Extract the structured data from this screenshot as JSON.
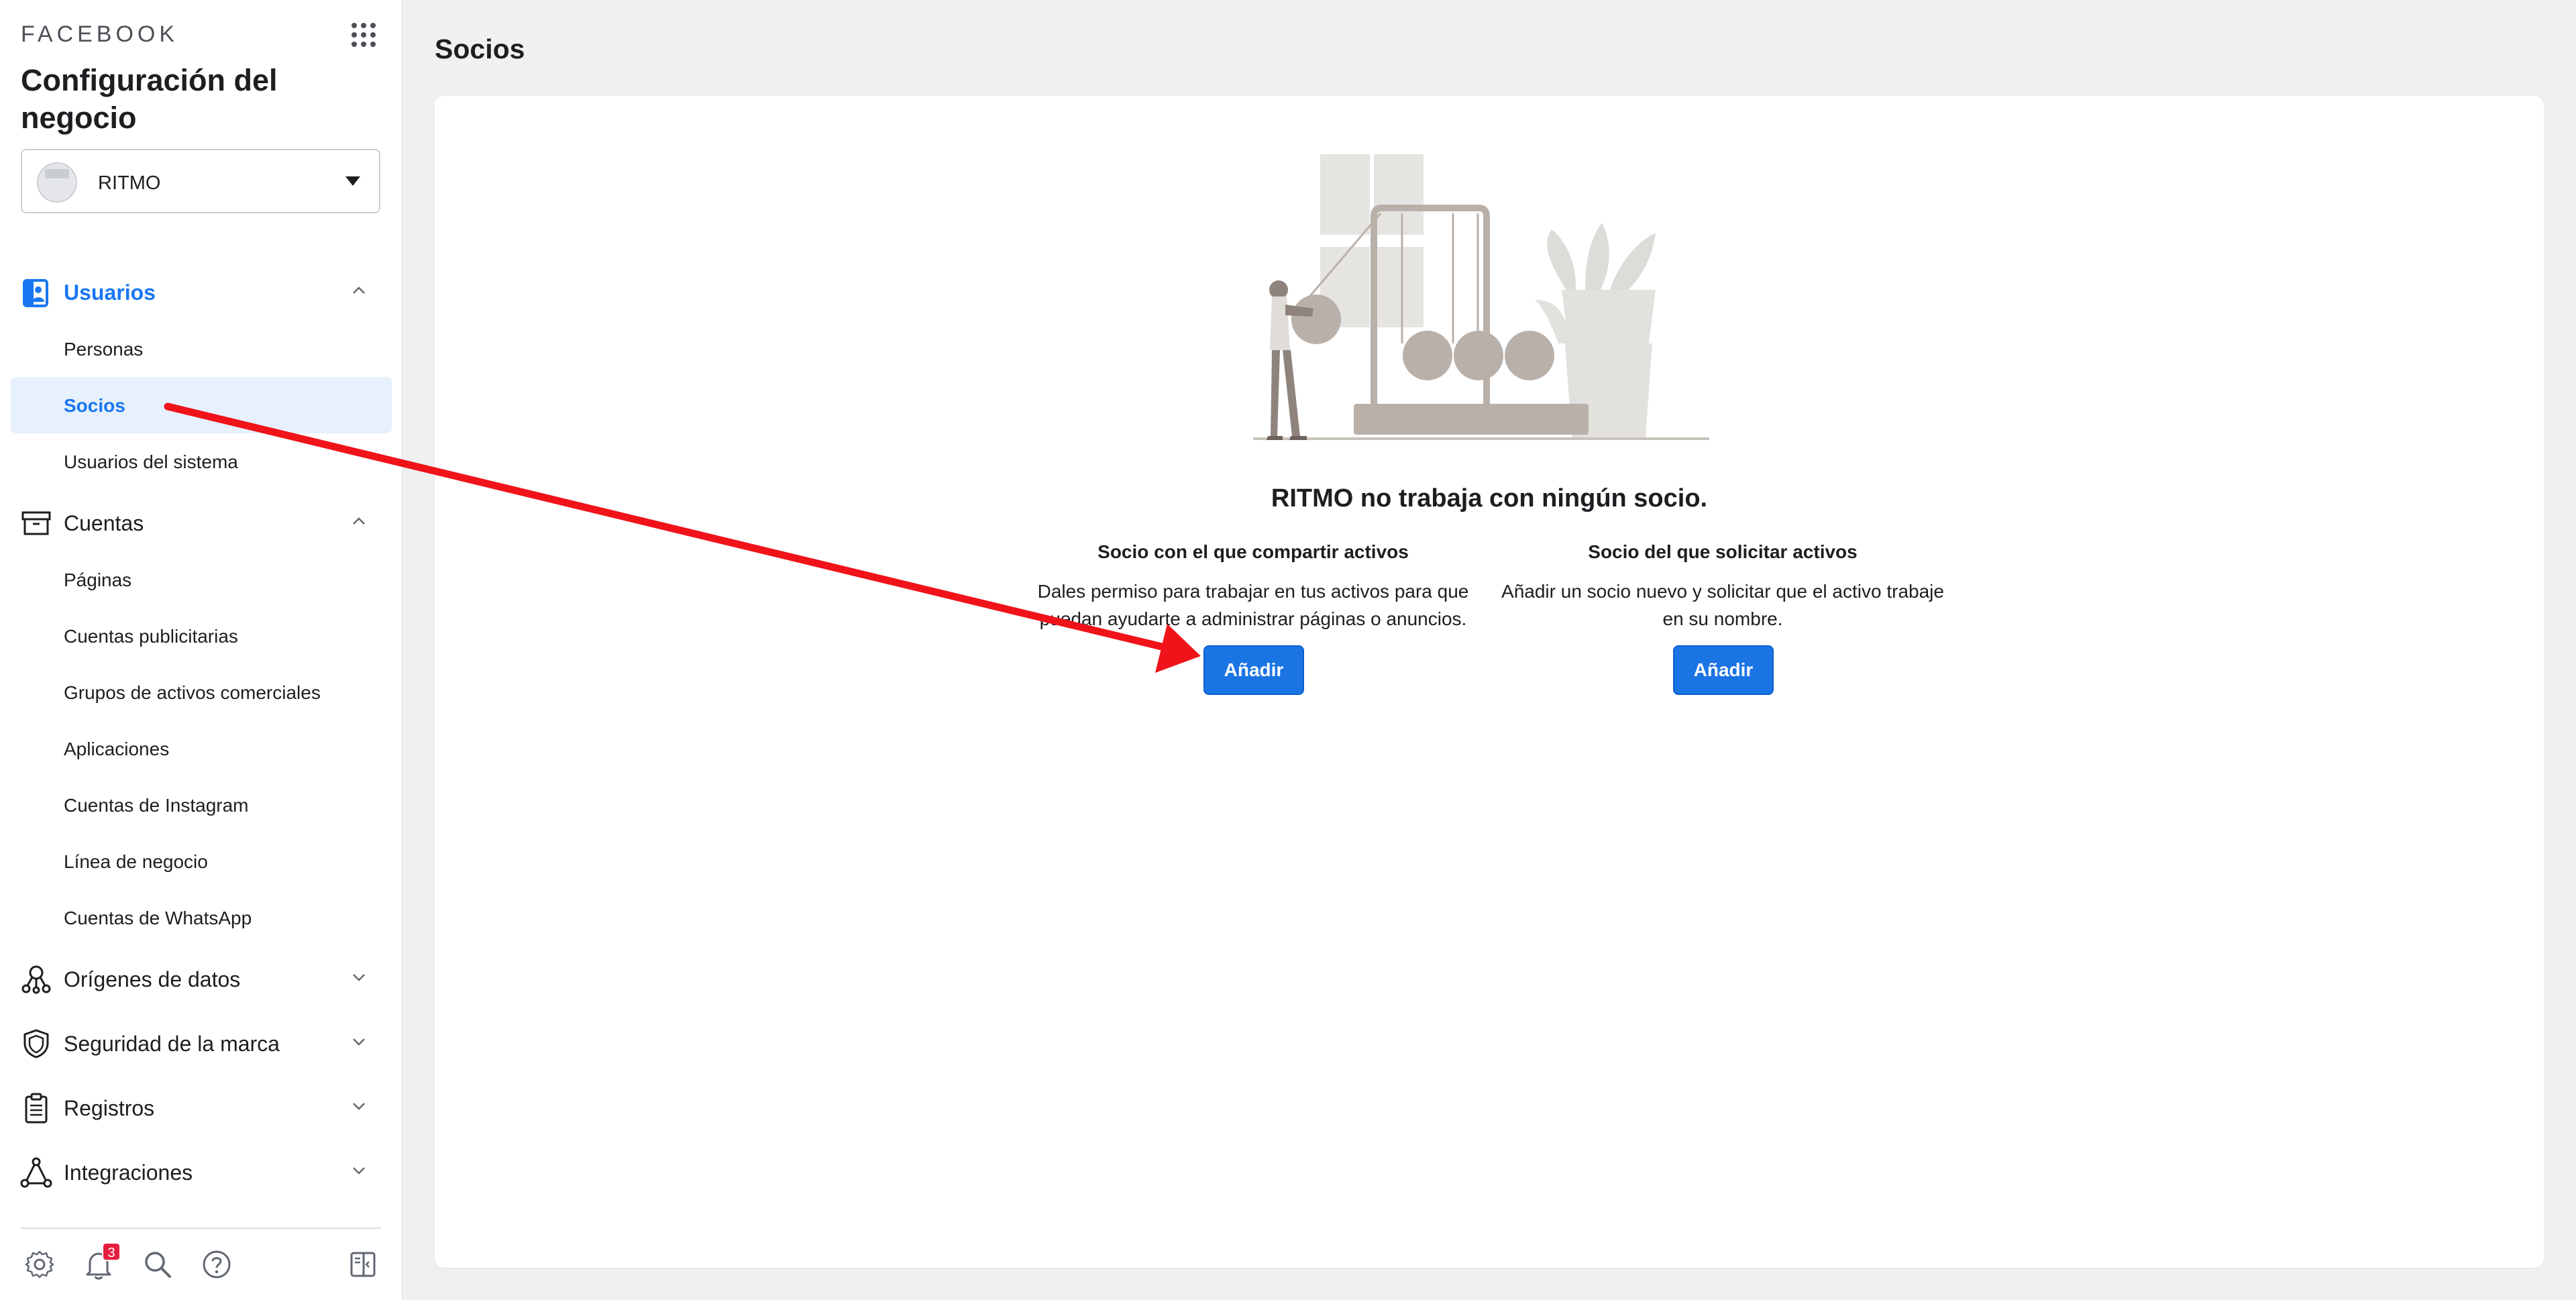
{
  "sidebar": {
    "brand": "FACEBOOK",
    "title": "Configuración del negocio",
    "business_selector": {
      "value": "RITMO"
    },
    "sections": [
      {
        "label": "Usuarios",
        "icon": "users-badge-icon",
        "expanded": true,
        "active": true,
        "items": [
          {
            "label": "Personas",
            "selected": false
          },
          {
            "label": "Socios",
            "selected": true
          },
          {
            "label": "Usuarios del sistema",
            "selected": false
          }
        ]
      },
      {
        "label": "Cuentas",
        "icon": "archive-box-icon",
        "expanded": true,
        "items": [
          {
            "label": "Páginas"
          },
          {
            "label": "Cuentas publicitarias"
          },
          {
            "label": "Grupos de activos comerciales"
          },
          {
            "label": "Aplicaciones"
          },
          {
            "label": "Cuentas de Instagram"
          },
          {
            "label": "Línea de negocio"
          },
          {
            "label": "Cuentas de WhatsApp"
          }
        ]
      },
      {
        "label": "Orígenes de datos",
        "icon": "data-sources-icon",
        "expanded": false
      },
      {
        "label": "Seguridad de la marca",
        "icon": "shield-icon",
        "expanded": false
      },
      {
        "label": "Registros",
        "icon": "clipboard-icon",
        "expanded": false
      },
      {
        "label": "Integraciones",
        "icon": "integrations-icon",
        "expanded": false
      }
    ],
    "footer": {
      "notification_count": "3",
      "icons": [
        "gear-icon",
        "bell-icon",
        "search-icon",
        "help-icon",
        "panel-toggle-icon"
      ]
    }
  },
  "main": {
    "title": "Socios",
    "empty_state": {
      "heading": "RITMO no trabaja con ningún socio.",
      "columns": [
        {
          "title": "Socio con el que compartir activos",
          "description": "Dales permiso para trabajar en tus activos para que puedan ayudarte a administrar páginas o anuncios.",
          "button": "Añadir"
        },
        {
          "title": "Socio del que solicitar activos",
          "description": "Añadir un socio nuevo y solicitar que el activo trabaje en su nombre.",
          "button": "Añadir"
        }
      ]
    }
  },
  "colors": {
    "accent": "#1877f2",
    "button": "#1b74e4",
    "selected_bg": "#e7f0fd",
    "badge": "#e41e3f",
    "annotation_arrow": "#f0131a"
  }
}
